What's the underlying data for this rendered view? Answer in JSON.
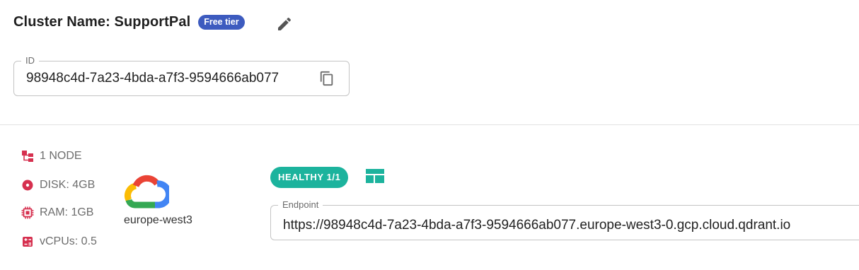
{
  "header": {
    "cluster_title": "Cluster Name: SupportPal",
    "tier_badge": "Free tier",
    "edit_icon": "pencil-icon"
  },
  "id_field": {
    "label": "ID",
    "value": "98948c4d-7a23-4bda-a7f3-9594666ab077",
    "copy_icon": "copy-icon"
  },
  "specs": {
    "nodes": "1 NODE",
    "disk": "DISK: 4GB",
    "ram": "RAM: 1GB",
    "vcpus": "vCPUs: 0.5"
  },
  "provider": {
    "logo": "google-cloud-logo",
    "region": "europe-west3"
  },
  "status": {
    "health": "HEALTHY 1/1",
    "dashboard_icon": "dashboard-layout-icon"
  },
  "endpoint": {
    "label": "Endpoint",
    "value": "https://98948c4d-7a23-4bda-a7f3-9594666ab077.europe-west3-0.gcp.cloud.qdrant.io"
  },
  "colors": {
    "tier_badge": "#3d5bbf",
    "health_badge": "#1cb39d",
    "spec_icon": "#d6304f",
    "dashboard_icon": "#1cb39d"
  }
}
